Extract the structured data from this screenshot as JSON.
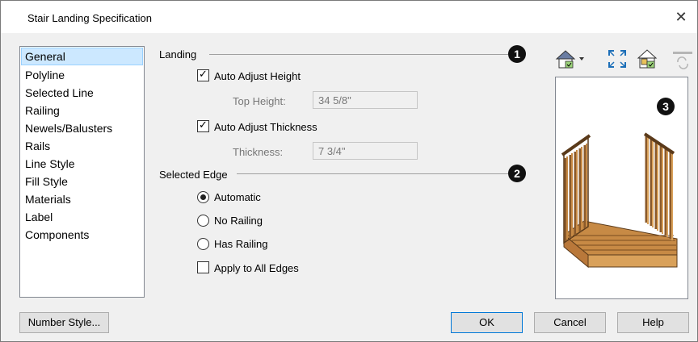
{
  "window": {
    "title": "Stair Landing Specification",
    "close_glyph": "✕"
  },
  "sidebar": {
    "items": [
      {
        "label": "General"
      },
      {
        "label": "Polyline"
      },
      {
        "label": "Selected Line"
      },
      {
        "label": "Railing"
      },
      {
        "label": "Newels/Balusters"
      },
      {
        "label": "Rails"
      },
      {
        "label": "Line Style"
      },
      {
        "label": "Fill Style"
      },
      {
        "label": "Materials"
      },
      {
        "label": "Label"
      },
      {
        "label": "Components"
      }
    ],
    "selected_index": 0
  },
  "landing": {
    "group_label": "Landing",
    "callout": "1",
    "auto_adjust_height": {
      "label": "Auto Adjust Height",
      "checked": true
    },
    "top_height": {
      "label": "Top Height:",
      "value": "34 5/8\""
    },
    "auto_adjust_thickness": {
      "label": "Auto Adjust Thickness",
      "checked": true
    },
    "thickness": {
      "label": "Thickness:",
      "value": "7 3/4\""
    }
  },
  "selected_edge": {
    "group_label": "Selected Edge",
    "callout": "2",
    "options": [
      {
        "label": "Automatic",
        "selected": true
      },
      {
        "label": "No Railing",
        "selected": false
      },
      {
        "label": "Has Railing",
        "selected": false
      }
    ],
    "apply_all": {
      "label": "Apply to All Edges",
      "checked": false
    }
  },
  "preview": {
    "callout": "3"
  },
  "buttons": {
    "number_style": "Number Style...",
    "ok": "OK",
    "cancel": "Cancel",
    "help": "Help"
  },
  "colors": {
    "selection": "#cce8ff",
    "wood_light": "#d9a15a",
    "wood_dark": "#8a5a2b",
    "accent": "#0078d7"
  }
}
